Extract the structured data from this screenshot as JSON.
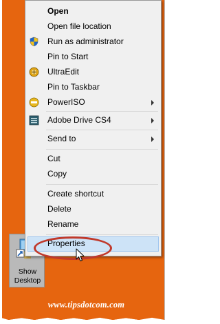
{
  "menu": {
    "items": [
      {
        "label": "Open",
        "bold": true,
        "icon": null,
        "submenu": false
      },
      {
        "label": "Open file location",
        "bold": false,
        "icon": null,
        "submenu": false
      },
      {
        "label": "Run as administrator",
        "bold": false,
        "icon": "uac-shield-icon",
        "submenu": false
      },
      {
        "label": "Pin to Start",
        "bold": false,
        "icon": null,
        "submenu": false
      },
      {
        "label": "UltraEdit",
        "bold": false,
        "icon": "ultraedit-icon",
        "submenu": false
      },
      {
        "label": "Pin to Taskbar",
        "bold": false,
        "icon": null,
        "submenu": false
      },
      {
        "label": "PowerISO",
        "bold": false,
        "icon": "poweriso-icon",
        "submenu": true
      },
      {
        "label": "Adobe Drive CS4",
        "bold": false,
        "icon": "adobe-drive-icon",
        "submenu": true
      },
      {
        "label": "Send to",
        "bold": false,
        "icon": null,
        "submenu": true
      },
      {
        "label": "Cut",
        "bold": false,
        "icon": null,
        "submenu": false
      },
      {
        "label": "Copy",
        "bold": false,
        "icon": null,
        "submenu": false
      },
      {
        "label": "Create shortcut",
        "bold": false,
        "icon": null,
        "submenu": false
      },
      {
        "label": "Delete",
        "bold": false,
        "icon": null,
        "submenu": false
      },
      {
        "label": "Rename",
        "bold": false,
        "icon": null,
        "submenu": false
      },
      {
        "label": "Properties",
        "bold": false,
        "icon": null,
        "submenu": false,
        "highlighted": true
      }
    ]
  },
  "shortcut": {
    "label": "Show Desktop",
    "icon": "show-desktop-icon"
  },
  "watermark": "www.tipsdotcom.com",
  "colors": {
    "desktop": "#e6650f",
    "menu_bg": "#f0f0f0",
    "highlight": "#cde3f7",
    "ellipse": "#c0392b"
  }
}
